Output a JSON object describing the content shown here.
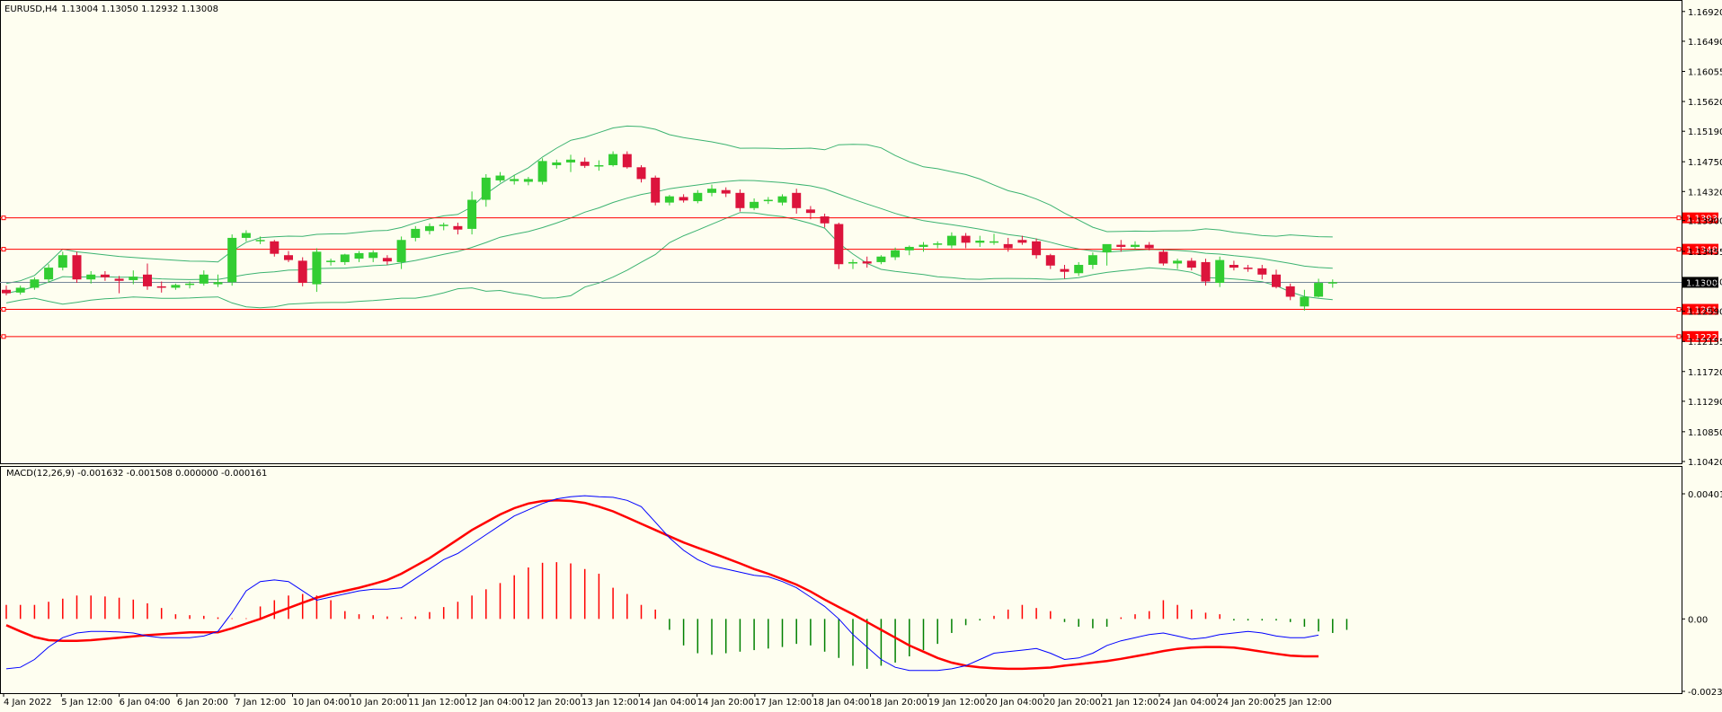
{
  "header": {
    "symbol": "EURUSD,H4",
    "ohlc": "1.13004 1.13050 1.12932 1.13008"
  },
  "macd_header": "MACD(12,26,9) -0.001632 -0.001508 0.000000 -0.000161",
  "colors": {
    "background": "#fefef0",
    "bull": "#32cd32",
    "bear": "#dc143c",
    "bands": "#3cb371",
    "level_line": "#ff0000",
    "current_line": "#778899",
    "macd_line": "#0000ff",
    "signal_line": "#ff0000",
    "hist_pos": "#ff0000",
    "hist_neg": "#008000"
  },
  "chart_data": [
    {
      "type": "candlestick",
      "title": "EURUSD,H4",
      "ylim": [
        1.1042,
        1.1706
      ],
      "price_ticks": [
        "1.16920",
        "1.16490",
        "1.16055",
        "1.15620",
        "1.15190",
        "1.14750",
        "1.14320",
        "1.13900",
        "1.13455",
        "1.13020",
        "1.12590",
        "1.12155",
        "1.11720",
        "1.11290",
        "1.10850",
        "1.10420"
      ],
      "x_labels": [
        "4 Jan 2022",
        "5 Jan 12:00",
        "6 Jan 04:00",
        "6 Jan 20:00",
        "7 Jan 12:00",
        "10 Jan 04:00",
        "10 Jan 20:00",
        "11 Jan 12:00",
        "12 Jan 04:00",
        "12 Jan 20:00",
        "13 Jan 12:00",
        "14 Jan 04:00",
        "14 Jan 20:00",
        "17 Jan 12:00",
        "18 Jan 04:00",
        "18 Jan 20:00",
        "19 Jan 12:00",
        "20 Jan 04:00",
        "20 Jan 20:00",
        "21 Jan 12:00",
        "24 Jan 04:00",
        "24 Jan 20:00",
        "25 Jan 12:00"
      ],
      "levels": [
        "1.13939",
        "1.13486",
        "1.12618",
        "1.12225"
      ],
      "current_price": "1.13008",
      "candles": [
        [
          1.129,
          1.1296,
          1.1282,
          1.1285
        ],
        [
          1.1286,
          1.1296,
          1.1283,
          1.1293
        ],
        [
          1.1293,
          1.1308,
          1.129,
          1.1305
        ],
        [
          1.1305,
          1.1327,
          1.13,
          1.1322
        ],
        [
          1.1322,
          1.1345,
          1.1318,
          1.134
        ],
        [
          1.134,
          1.1345,
          1.13,
          1.1305
        ],
        [
          1.1305,
          1.1317,
          1.1299,
          1.1312
        ],
        [
          1.1312,
          1.1317,
          1.1303,
          1.1308
        ],
        [
          1.1306,
          1.131,
          1.1285,
          1.1303
        ],
        [
          1.1304,
          1.1318,
          1.1298,
          1.1309
        ],
        [
          1.1312,
          1.1328,
          1.129,
          1.1295
        ],
        [
          1.1295,
          1.1302,
          1.1286,
          1.1293
        ],
        [
          1.1293,
          1.1299,
          1.129,
          1.1297
        ],
        [
          1.1297,
          1.1302,
          1.1292,
          1.1299
        ],
        [
          1.1299,
          1.1318,
          1.1296,
          1.1312
        ],
        [
          1.1298,
          1.1312,
          1.1294,
          1.1301
        ],
        [
          1.1301,
          1.137,
          1.1296,
          1.1365
        ],
        [
          1.1365,
          1.1376,
          1.136,
          1.1372
        ],
        [
          1.1362,
          1.1367,
          1.1356,
          1.1362
        ],
        [
          1.136,
          1.1362,
          1.1338,
          1.1342
        ],
        [
          1.134,
          1.1346,
          1.133,
          1.1333
        ],
        [
          1.1332,
          1.1337,
          1.1295,
          1.13
        ],
        [
          1.1298,
          1.135,
          1.1287,
          1.1345
        ],
        [
          1.133,
          1.1335,
          1.1325,
          1.1332
        ],
        [
          1.133,
          1.1342,
          1.1326,
          1.1341
        ],
        [
          1.1335,
          1.1346,
          1.133,
          1.1343
        ],
        [
          1.1336,
          1.1347,
          1.133,
          1.1344
        ],
        [
          1.1336,
          1.134,
          1.1326,
          1.1331
        ],
        [
          1.133,
          1.1367,
          1.132,
          1.1362
        ],
        [
          1.1365,
          1.1382,
          1.136,
          1.1378
        ],
        [
          1.1375,
          1.1386,
          1.137,
          1.1382
        ],
        [
          1.1383,
          1.1387,
          1.1376,
          1.1384
        ],
        [
          1.1382,
          1.1387,
          1.137,
          1.1377
        ],
        [
          1.1378,
          1.1432,
          1.137,
          1.142
        ],
        [
          1.142,
          1.1457,
          1.141,
          1.1452
        ],
        [
          1.1448,
          1.146,
          1.1445,
          1.1455
        ],
        [
          1.1447,
          1.1456,
          1.1442,
          1.145
        ],
        [
          1.1446,
          1.1453,
          1.1441,
          1.145
        ],
        [
          1.1446,
          1.148,
          1.1442,
          1.1476
        ],
        [
          1.147,
          1.1478,
          1.1465,
          1.1474
        ],
        [
          1.1474,
          1.1485,
          1.146,
          1.1478
        ],
        [
          1.1475,
          1.1481,
          1.1466,
          1.1469
        ],
        [
          1.1469,
          1.1477,
          1.1462,
          1.147
        ],
        [
          1.147,
          1.149,
          1.1468,
          1.1486
        ],
        [
          1.1486,
          1.149,
          1.1465,
          1.1467
        ],
        [
          1.1467,
          1.147,
          1.1445,
          1.145
        ],
        [
          1.1452,
          1.1455,
          1.1412,
          1.1416
        ],
        [
          1.1416,
          1.1427,
          1.1412,
          1.1425
        ],
        [
          1.1424,
          1.1428,
          1.1416,
          1.1419
        ],
        [
          1.1418,
          1.1434,
          1.1415,
          1.143
        ],
        [
          1.143,
          1.1442,
          1.1425,
          1.1436
        ],
        [
          1.1434,
          1.1438,
          1.1424,
          1.1429
        ],
        [
          1.143,
          1.1435,
          1.1403,
          1.1408
        ],
        [
          1.1408,
          1.1422,
          1.1405,
          1.1417
        ],
        [
          1.1418,
          1.1424,
          1.1414,
          1.142
        ],
        [
          1.1416,
          1.1428,
          1.1412,
          1.1425
        ],
        [
          1.143,
          1.1436,
          1.14,
          1.1408
        ],
        [
          1.1406,
          1.1411,
          1.1392,
          1.1401
        ],
        [
          1.1396,
          1.14,
          1.138,
          1.1386
        ],
        [
          1.1385,
          1.1387,
          1.132,
          1.1327
        ],
        [
          1.1328,
          1.1334,
          1.132,
          1.133
        ],
        [
          1.1331,
          1.1338,
          1.1322,
          1.1328
        ],
        [
          1.133,
          1.134,
          1.1327,
          1.1338
        ],
        [
          1.1337,
          1.1351,
          1.1333,
          1.1347
        ],
        [
          1.1347,
          1.1354,
          1.134,
          1.1352
        ],
        [
          1.1352,
          1.1359,
          1.1345,
          1.1355
        ],
        [
          1.1355,
          1.136,
          1.135,
          1.1357
        ],
        [
          1.1354,
          1.1373,
          1.135,
          1.1368
        ],
        [
          1.1368,
          1.1372,
          1.135,
          1.1358
        ],
        [
          1.1358,
          1.1368,
          1.1352,
          1.1361
        ],
        [
          1.1358,
          1.1371,
          1.1355,
          1.136
        ],
        [
          1.1356,
          1.1365,
          1.1345,
          1.135
        ],
        [
          1.1362,
          1.1368,
          1.1355,
          1.1358
        ],
        [
          1.136,
          1.1364,
          1.1335,
          1.134
        ],
        [
          1.134,
          1.1342,
          1.132,
          1.1325
        ],
        [
          1.132,
          1.1326,
          1.1306,
          1.1316
        ],
        [
          1.1314,
          1.133,
          1.131,
          1.1326
        ],
        [
          1.1326,
          1.1344,
          1.132,
          1.134
        ],
        [
          1.1344,
          1.135,
          1.1325,
          1.1356
        ],
        [
          1.1355,
          1.1362,
          1.1345,
          1.1352
        ],
        [
          1.1352,
          1.136,
          1.1349,
          1.1355
        ],
        [
          1.1355,
          1.1359,
          1.1347,
          1.135
        ],
        [
          1.1345,
          1.1348,
          1.1325,
          1.1328
        ],
        [
          1.1328,
          1.1335,
          1.132,
          1.1332
        ],
        [
          1.1332,
          1.1336,
          1.1318,
          1.1322
        ],
        [
          1.133,
          1.1335,
          1.1296,
          1.1302
        ],
        [
          1.13,
          1.1338,
          1.1294,
          1.1333
        ],
        [
          1.1326,
          1.1332,
          1.1318,
          1.1322
        ],
        [
          1.1322,
          1.1326,
          1.1316,
          1.132
        ],
        [
          1.1321,
          1.1326,
          1.1305,
          1.1312
        ],
        [
          1.1312,
          1.1319,
          1.1292,
          1.1294
        ],
        [
          1.1295,
          1.1299,
          1.1275,
          1.128
        ],
        [
          1.1266,
          1.129,
          1.126,
          1.128
        ],
        [
          1.128,
          1.1306,
          1.1279,
          1.13
        ],
        [
          1.13,
          1.1305,
          1.1293,
          1.1301
        ]
      ]
    },
    {
      "type": "line",
      "title": "MACD(12,26,9)",
      "ylim": [
        -0.002322,
        0.004011
      ],
      "y_ticks": [
        "0.004011",
        "0.00",
        "-0.002322"
      ],
      "series": [
        {
          "name": "MACD",
          "values": [
            -0.0016,
            -0.00155,
            -0.0013,
            -0.0009,
            -0.0006,
            -0.00045,
            -0.0004,
            -0.0004,
            -0.00042,
            -0.00045,
            -0.00055,
            -0.0006,
            -0.0006,
            -0.0006,
            -0.00055,
            -0.0004,
            0.0002,
            0.0009,
            0.0012,
            0.00125,
            0.0012,
            0.0009,
            0.0006,
            0.0007,
            0.0008,
            0.0009,
            0.00095,
            0.00095,
            0.001,
            0.0013,
            0.0016,
            0.0019,
            0.0021,
            0.0024,
            0.0027,
            0.003,
            0.0033,
            0.0035,
            0.0037,
            0.00385,
            0.00392,
            0.00395,
            0.00392,
            0.0039,
            0.0038,
            0.0036,
            0.0031,
            0.0026,
            0.0022,
            0.0019,
            0.0017,
            0.0016,
            0.0015,
            0.0014,
            0.00135,
            0.0012,
            0.001,
            0.0007,
            0.0004,
            0.0,
            -0.0005,
            -0.0009,
            -0.0013,
            -0.00155,
            -0.00165,
            -0.00165,
            -0.00165,
            -0.0016,
            -0.0015,
            -0.0013,
            -0.0011,
            -0.00105,
            -0.001,
            -0.00095,
            -0.0011,
            -0.0013,
            -0.00125,
            -0.0011,
            -0.00085,
            -0.0007,
            -0.0006,
            -0.0005,
            -0.00045,
            -0.00055,
            -0.00065,
            -0.0006,
            -0.0005,
            -0.00045,
            -0.0004,
            -0.00045,
            -0.00055,
            -0.0006,
            -0.0006,
            -0.00052
          ]
        },
        {
          "name": "Signal",
          "values": [
            -0.0002,
            -0.0004,
            -0.00058,
            -0.00068,
            -0.0007,
            -0.0007,
            -0.00068,
            -0.00064,
            -0.0006,
            -0.00056,
            -0.00052,
            -0.00049,
            -0.00046,
            -0.00043,
            -0.00043,
            -0.00043,
            -0.0003,
            -0.00015,
            0.0,
            0.00018,
            0.00035,
            0.00052,
            0.00068,
            0.0008,
            0.0009,
            0.001,
            0.00112,
            0.00125,
            0.00145,
            0.0017,
            0.00195,
            0.00225,
            0.00255,
            0.00285,
            0.0031,
            0.00335,
            0.00355,
            0.0037,
            0.00378,
            0.0038,
            0.00378,
            0.00372,
            0.0036,
            0.00345,
            0.00325,
            0.00305,
            0.00285,
            0.00265,
            0.00245,
            0.00228,
            0.00212,
            0.00195,
            0.00178,
            0.0016,
            0.00145,
            0.00128,
            0.0011,
            0.00088,
            0.00062,
            0.00038,
            0.00015,
            -0.0001,
            -0.00035,
            -0.0006,
            -0.00085,
            -0.00105,
            -0.00125,
            -0.0014,
            -0.0015,
            -0.00155,
            -0.00158,
            -0.0016,
            -0.0016,
            -0.00158,
            -0.00156,
            -0.0015,
            -0.00145,
            -0.0014,
            -0.00135,
            -0.00128,
            -0.0012,
            -0.00112,
            -0.00103,
            -0.00096,
            -0.00092,
            -0.0009,
            -0.0009,
            -0.00092,
            -0.00098,
            -0.00105,
            -0.00112,
            -0.00118,
            -0.0012,
            -0.0012
          ]
        },
        {
          "name": "Histogram",
          "values": [
            0.00045,
            0.00045,
            0.00045,
            0.00055,
            0.00065,
            0.00075,
            0.00075,
            0.00072,
            0.00068,
            0.00062,
            0.0005,
            0.00035,
            0.00015,
            0.00012,
            0.0001,
            5e-05,
            2e-05,
            2e-05,
            0.0004,
            0.0006,
            0.00075,
            0.0008,
            0.00075,
            0.0006,
            0.00025,
            0.00015,
            0.00012,
            8e-05,
            5e-05,
            8e-05,
            0.00022,
            0.00038,
            0.00055,
            0.00075,
            0.00095,
            0.00115,
            0.0014,
            0.00165,
            0.0018,
            0.00182,
            0.00178,
            0.0016,
            0.00145,
            0.001,
            0.0008,
            0.00045,
            0.0003,
            -0.00035,
            -0.00085,
            -0.0011,
            -0.00115,
            -0.0011,
            -0.00105,
            -0.001,
            -0.00095,
            -0.0009,
            -0.0008,
            -0.00085,
            -0.00105,
            -0.00125,
            -0.0015,
            -0.0016,
            -0.0015,
            -0.0014,
            -0.0012,
            -0.001,
            -0.0008,
            -0.00045,
            -0.0002,
            -5e-05,
            0.0001,
            0.0003,
            0.00045,
            0.00035,
            0.00025,
            -0.0001,
            -0.00025,
            -0.0003,
            -0.00025,
            5e-05,
            0.00015,
            0.00025,
            0.0006,
            0.00045,
            0.0003,
            0.0002,
            0.00015,
            -5e-05,
            -5e-05,
            -5e-05,
            -5e-05,
            -0.0001,
            -0.00025,
            -0.0004,
            -0.00045,
            -0.00035
          ]
        }
      ]
    }
  ]
}
